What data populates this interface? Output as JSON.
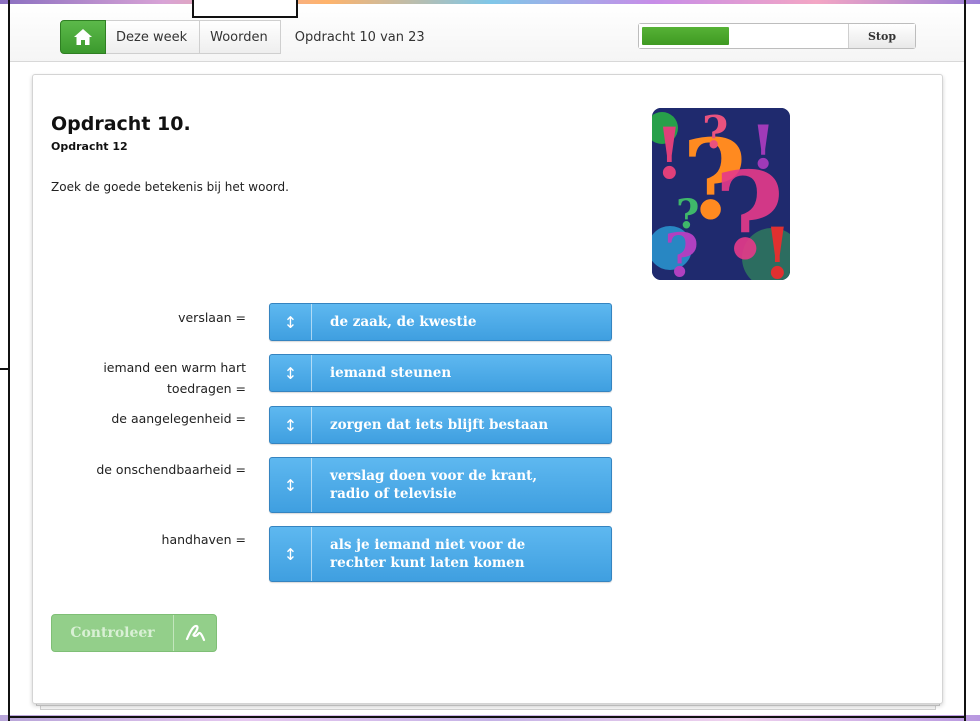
{
  "nav": {
    "home_icon": "home-icon",
    "crumbs": [
      "Deze week",
      "Woorden"
    ],
    "position_text": "Opdracht 10 van 23"
  },
  "progress": {
    "fraction": 0.43,
    "stop_label": "Stop",
    "fill_color": "#4aa62c"
  },
  "exercise": {
    "title": "Opdracht 10.",
    "subtitle": "Opdracht 12",
    "instruction": "Zoek de goede betekenis bij het woord.",
    "image_icon": "question-marks-illustration"
  },
  "pairs": [
    {
      "term": "verslaan =",
      "answer": "de zaak, de kwestie"
    },
    {
      "term": "iemand een warm hart toedragen =",
      "answer": "iemand steunen"
    },
    {
      "term": "de aangelegenheid =",
      "answer": "zorgen dat iets blijft bestaan"
    },
    {
      "term": "de onschendbaarheid =",
      "answer": "verslag doen voor de krant, radio of televisie"
    },
    {
      "term": "handhaven =",
      "answer": "als je iemand niet voor de rechter kunt laten komen"
    }
  ],
  "check": {
    "label": "Controleer",
    "icon": "handwriting-check-icon"
  },
  "colors": {
    "accent_green": "#3b9a2d",
    "tile_blue": "#4aa8e6",
    "check_green": "#93cf8a"
  }
}
